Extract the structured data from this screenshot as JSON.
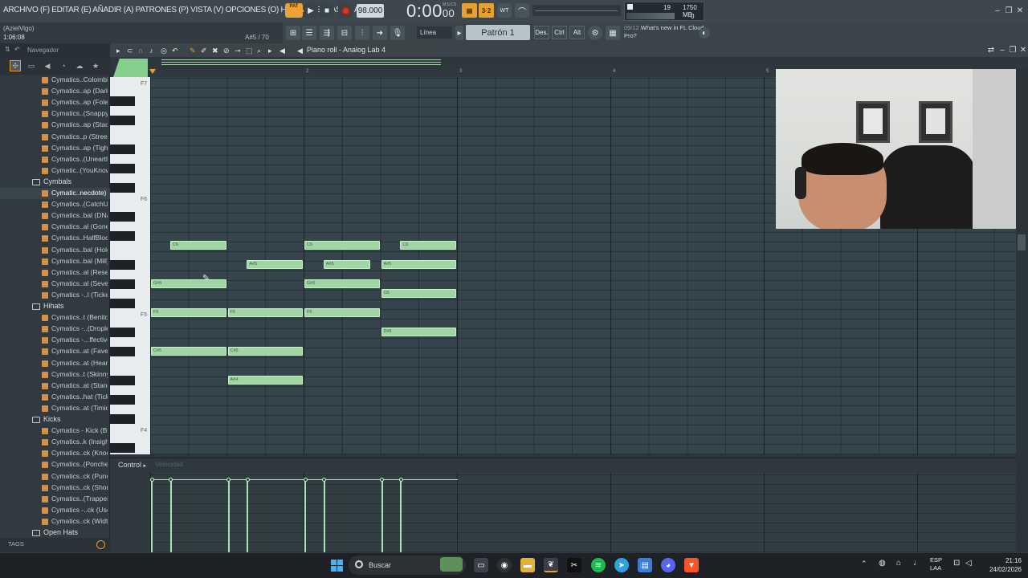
{
  "menu": {
    "text": "ARCHIVO (F) EDITAR (E) AÑADIR (A) PATRONES (P) VISTA (V) OPCIONES (O) HERRAMIENTAS (T) AYUDA"
  },
  "hint": {
    "left": "(AzielVigo)",
    "time": "1:06:08",
    "note": "A#5 / 70"
  },
  "transport": {
    "pat_label": "PAT",
    "tempo": "98.000",
    "time_main": "0:00",
    "time_sub": "00",
    "mcs": "M:S:CS"
  },
  "cpu": {
    "cores": "19",
    "memory": "1750 MB",
    "zero": "0"
  },
  "toolbar2": {
    "snap": "Línea",
    "pattern": "Patrón 1",
    "des": "Des.",
    "ctrl": "Ctrl",
    "alt": "Alt"
  },
  "news": {
    "date": "09/12",
    "text": "What's new in FL Cloud Pro?"
  },
  "browser": {
    "title": "Navegador",
    "tags": "TAGS",
    "items": [
      {
        "type": "item",
        "label": "Cymatics..Colombia"
      },
      {
        "type": "item",
        "label": "Cymatics..ap (Dark)"
      },
      {
        "type": "item",
        "label": "Cymatics..ap (Foley)"
      },
      {
        "type": "item",
        "label": "Cymatics..(Snappy)"
      },
      {
        "type": "item",
        "label": "Cymatics..ap (Stack)"
      },
      {
        "type": "item",
        "label": "Cymatics..p (Street)"
      },
      {
        "type": "item",
        "label": "Cymatics..ap (Tight)"
      },
      {
        "type": "item",
        "label": "Cymatics..(Unearth)"
      },
      {
        "type": "item",
        "label": "Cymatic..(YouKnow)"
      },
      {
        "type": "folder",
        "label": "Cymbals"
      },
      {
        "type": "item",
        "label": "Cymatic..necdote)",
        "selected": true
      },
      {
        "type": "item",
        "label": "Cymatics..(CatchUp)"
      },
      {
        "type": "item",
        "label": "Cymatics..bal (DNA)"
      },
      {
        "type": "item",
        "label": "Cymatics..al (Goner)"
      },
      {
        "type": "item",
        "label": "Cymatics..HalfBlock)"
      },
      {
        "type": "item",
        "label": "Cymatics..bal (Hold)"
      },
      {
        "type": "item",
        "label": "Cymatics..bal (Mill)"
      },
      {
        "type": "item",
        "label": "Cymatics..al (Reset)"
      },
      {
        "type": "item",
        "label": "Cymatics..al (Seven)"
      },
      {
        "type": "item",
        "label": "Cymatics -..l (Ticket)"
      },
      {
        "type": "folder",
        "label": "Hihats"
      },
      {
        "type": "item",
        "label": "Cymatics..t (Benito)"
      },
      {
        "type": "item",
        "label": "Cymatics -..(Droplet)"
      },
      {
        "type": "item",
        "label": "Cymatics -...ffective)"
      },
      {
        "type": "item",
        "label": "Cymatics..at (Favela)"
      },
      {
        "type": "item",
        "label": "Cymatics..at (Heard)"
      },
      {
        "type": "item",
        "label": "Cymatics..t (Skinny)"
      },
      {
        "type": "item",
        "label": "Cymatics..at (Stand)"
      },
      {
        "type": "item",
        "label": "Cymatics..hat (Tick)"
      },
      {
        "type": "item",
        "label": "Cymatics..at (Timid)"
      },
      {
        "type": "folder",
        "label": "Kicks"
      },
      {
        "type": "item",
        "label": "Cymatics - Kick (Big)"
      },
      {
        "type": "item",
        "label": "Cymatics..k (Insight)"
      },
      {
        "type": "item",
        "label": "Cymatics..ck (Knock)"
      },
      {
        "type": "item",
        "label": "Cymatics..(Ponche)"
      },
      {
        "type": "item",
        "label": "Cymatics..ck (Punch)"
      },
      {
        "type": "item",
        "label": "Cymatics..ck (Short)"
      },
      {
        "type": "item",
        "label": "Cymatics..(Trapper)"
      },
      {
        "type": "item",
        "label": "Cymatics -..ck (User)"
      },
      {
        "type": "item",
        "label": "Cymatics..ck (Width)"
      },
      {
        "type": "folder",
        "label": "Open Hats"
      }
    ]
  },
  "piano_roll": {
    "title": "Piano roll - Analog Lab 4",
    "bars": [
      "2",
      "3",
      "4",
      "5"
    ],
    "octave_labels": [
      "F7",
      "F6",
      "F5",
      "F4"
    ],
    "control_label": "Control",
    "control_sub": "Velocidad",
    "notes": [
      {
        "label": "C6",
        "pitch": "C6",
        "start": 0.125,
        "length": 0.375
      },
      {
        "label": "C6",
        "pitch": "C6",
        "start": 1.0,
        "length": 0.5
      },
      {
        "label": "C6",
        "pitch": "C6",
        "start": 1.625,
        "length": 0.375
      },
      {
        "label": "A#5",
        "pitch": "A#5",
        "start": 0.625,
        "length": 0.375
      },
      {
        "label": "A#5",
        "pitch": "A#5",
        "start": 1.125,
        "length": 0.3125
      },
      {
        "label": "A#5",
        "pitch": "A#5",
        "start": 1.5,
        "length": 0.5
      },
      {
        "label": "G#5",
        "pitch": "G#5",
        "start": 0.0,
        "length": 0.5
      },
      {
        "label": "G#5",
        "pitch": "G#5",
        "start": 1.0,
        "length": 0.5
      },
      {
        "label": "G5",
        "pitch": "G5",
        "start": 1.5,
        "length": 0.5
      },
      {
        "label": "F5",
        "pitch": "F5",
        "start": 0.0,
        "length": 0.5
      },
      {
        "label": "F5",
        "pitch": "F5",
        "start": 0.5,
        "length": 0.5
      },
      {
        "label": "F5",
        "pitch": "F5",
        "start": 1.0,
        "length": 0.5
      },
      {
        "label": "D#5",
        "pitch": "D#5",
        "start": 1.5,
        "length": 0.5
      },
      {
        "label": "C#5",
        "pitch": "C#5",
        "start": 0.0,
        "length": 0.5
      },
      {
        "label": "C#5",
        "pitch": "C#5",
        "start": 0.5,
        "length": 0.5
      },
      {
        "label": "A#4",
        "pitch": "A#4",
        "start": 0.5,
        "length": 0.5
      }
    ]
  },
  "taskbar": {
    "search": "Buscar",
    "lang1": "ESP",
    "lang2": "LAA",
    "time": "21:16",
    "date": "24/02/2026"
  },
  "colors": {
    "note": "#9fd6a6",
    "accent": "#e6a130",
    "record": "#d23b2a"
  }
}
